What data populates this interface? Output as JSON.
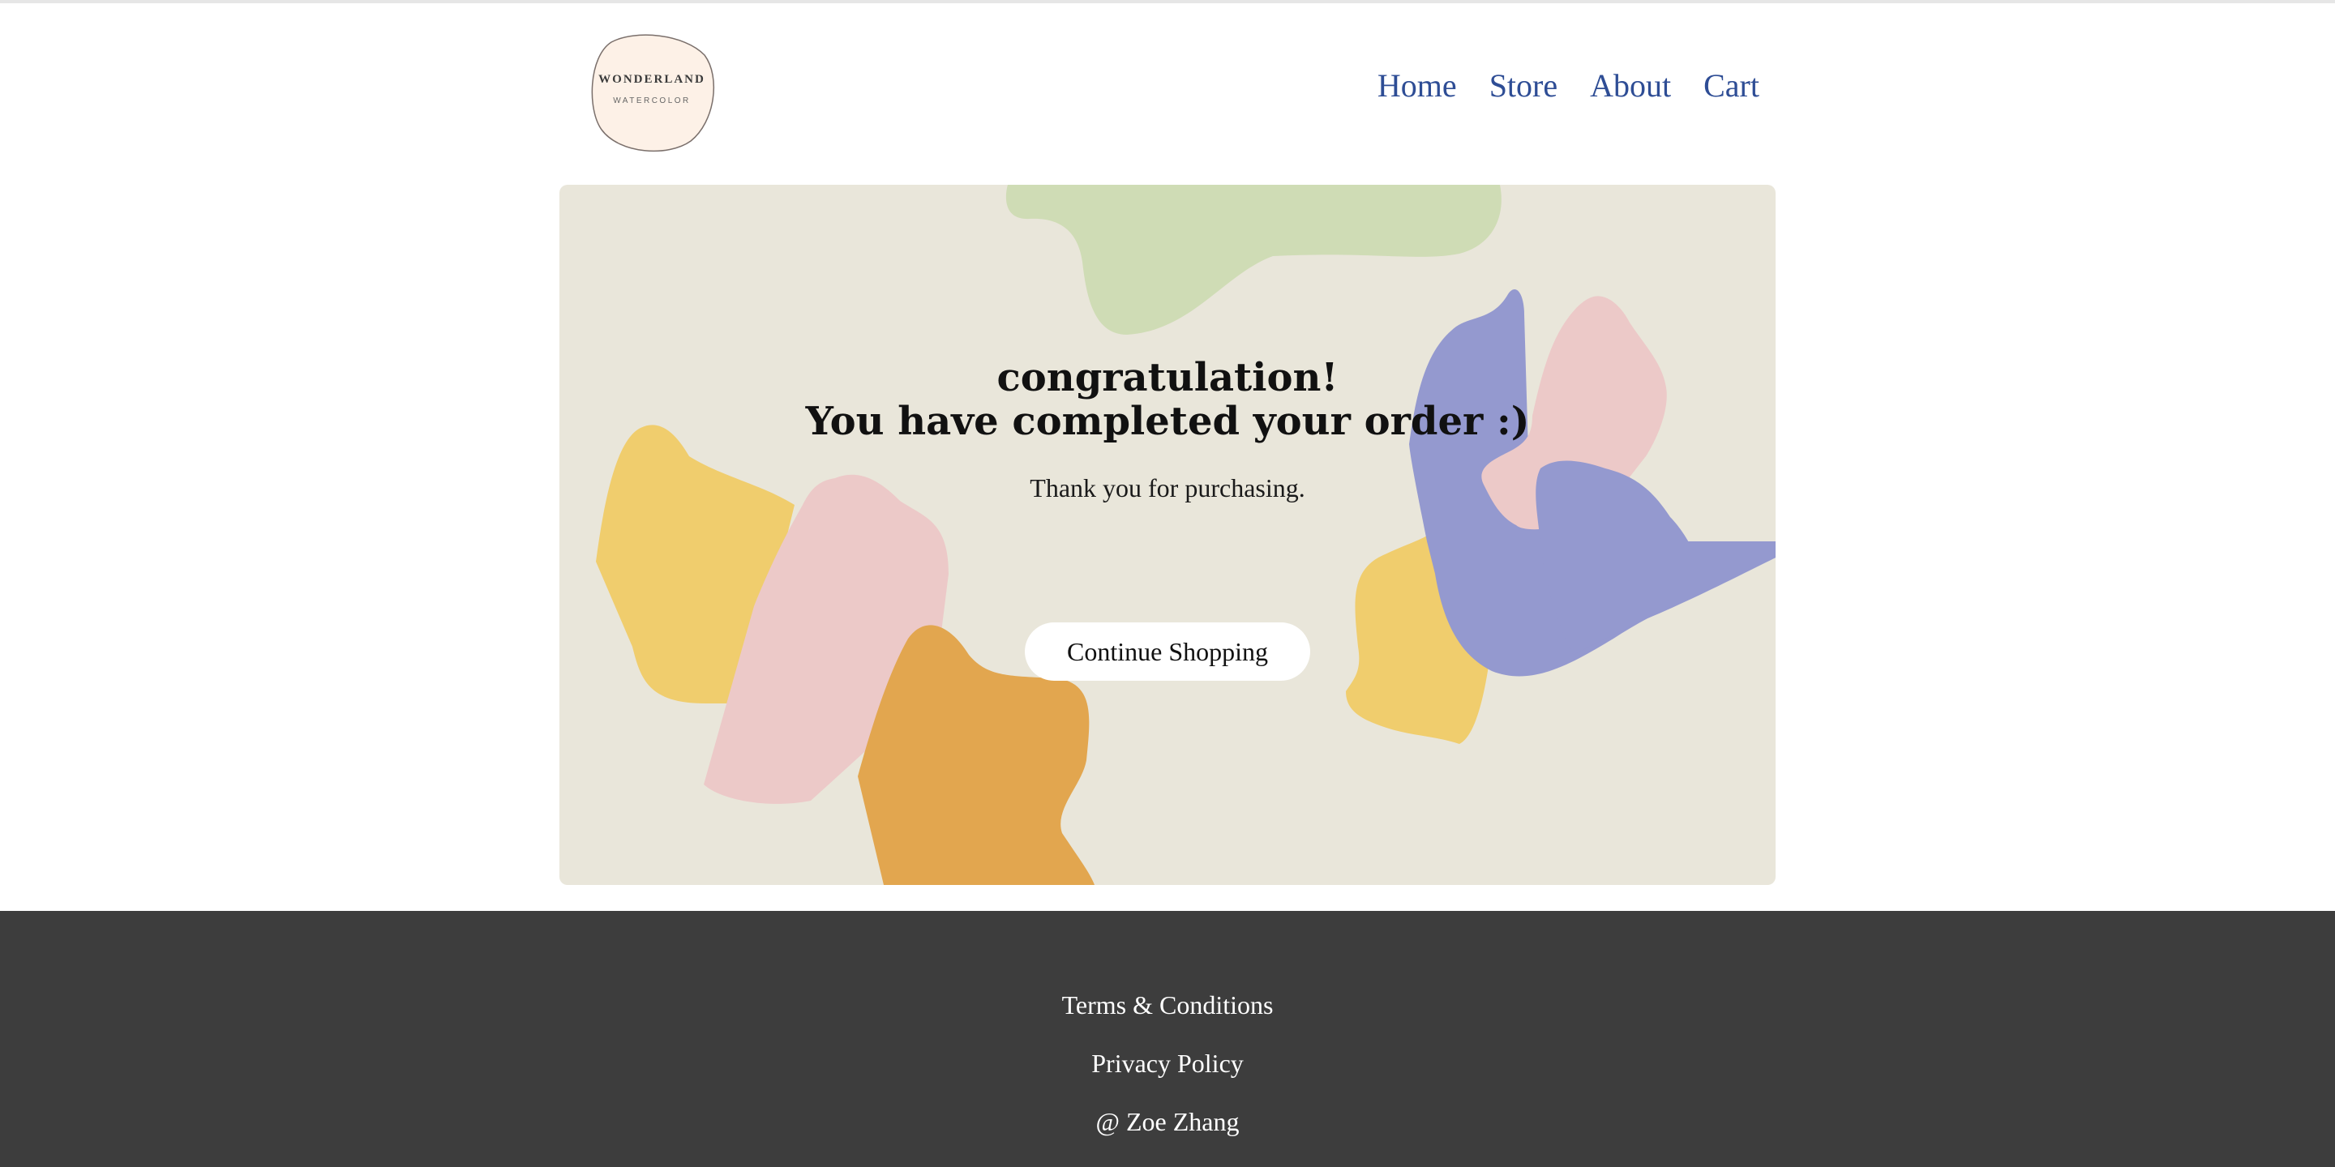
{
  "header": {
    "logo": {
      "name": "WONDERLAND",
      "sub": "WATERCOLOR"
    },
    "nav": [
      {
        "label": "Home"
      },
      {
        "label": "Store"
      },
      {
        "label": "About"
      },
      {
        "label": "Cart"
      }
    ]
  },
  "hero": {
    "title_line1": "congratulation!",
    "title_line2": "You have completed your order :)",
    "message": "Thank you for purchasing.",
    "cta_label": "Continue Shopping",
    "colors": {
      "background": "#e9e6da",
      "green": "#cfdcb5",
      "yellow": "#f0cd6d",
      "pink": "#ecc9c8",
      "orange": "#e2a64f",
      "purple": "#9499cf"
    }
  },
  "footer": {
    "links": [
      {
        "label": "Terms & Conditions"
      },
      {
        "label": "Privacy Policy"
      }
    ],
    "copyright": "@ Zoe Zhang"
  },
  "colors": {
    "nav_link": "#2e4d95",
    "footer_bg": "#3d3d3d"
  }
}
